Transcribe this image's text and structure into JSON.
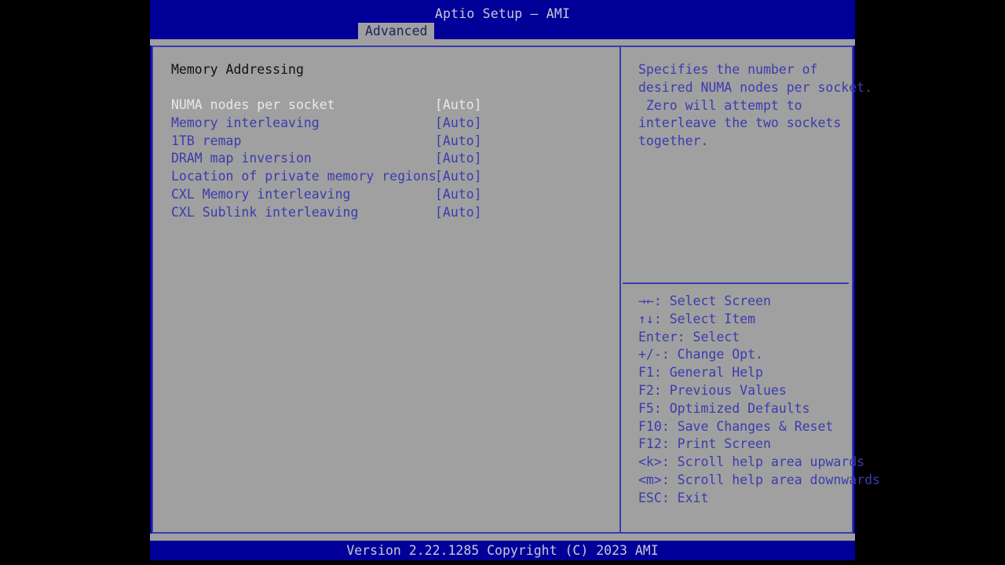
{
  "window": {
    "title": "Aptio Setup – AMI",
    "tabs": [
      {
        "label": "Advanced",
        "active": true
      }
    ]
  },
  "colors": {
    "screen_background": "#000000",
    "window_blue": "#000099",
    "panel_gray": "#a0a0a0",
    "border_blue": "#3b3bb0",
    "text_blue": "#3b3bb0",
    "text_selected": "#e8e8e8",
    "text_heading": "#101010",
    "title_text": "#c8c8d8",
    "tab_active_text": "#202060"
  },
  "main": {
    "section_title": "Memory Addressing",
    "settings": [
      {
        "label": "NUMA nodes per socket",
        "value": "[Auto]",
        "selected": true
      },
      {
        "label": "Memory interleaving",
        "value": "[Auto]",
        "selected": false
      },
      {
        "label": "1TB remap",
        "value": "[Auto]",
        "selected": false
      },
      {
        "label": "DRAM map inversion",
        "value": "[Auto]",
        "selected": false
      },
      {
        "label": "Location of private memory regions",
        "value": "[Auto]",
        "selected": false
      },
      {
        "label": "CXL Memory interleaving",
        "value": "[Auto]",
        "selected": false
      },
      {
        "label": "CXL Sublink interleaving",
        "value": "[Auto]",
        "selected": false
      }
    ]
  },
  "help": {
    "description_lines": [
      "Specifies the number of",
      "desired NUMA nodes per socket.",
      " Zero will attempt to",
      "interleave the two sockets",
      "together."
    ],
    "shortcuts": [
      {
        "keys": "→←",
        "text": ": Select Screen"
      },
      {
        "keys": "↑↓",
        "text": ": Select Item"
      },
      {
        "keys": "Enter",
        "text": ": Select"
      },
      {
        "keys": "+/-",
        "text": ": Change Opt."
      },
      {
        "keys": "F1",
        "text": ": General Help"
      },
      {
        "keys": "F2",
        "text": ": Previous Values"
      },
      {
        "keys": "F5",
        "text": ": Optimized Defaults"
      },
      {
        "keys": "F10",
        "text": ": Save Changes & Reset"
      },
      {
        "keys": "F12",
        "text": ": Print Screen"
      },
      {
        "keys": "<k>",
        "text": ": Scroll help area upwards"
      },
      {
        "keys": "<m>",
        "text": ": Scroll help area downwards"
      },
      {
        "keys": "ESC",
        "text": ": Exit"
      }
    ]
  },
  "footer": {
    "version": "Version 2.22.1285 Copyright (C) 2023 AMI"
  }
}
